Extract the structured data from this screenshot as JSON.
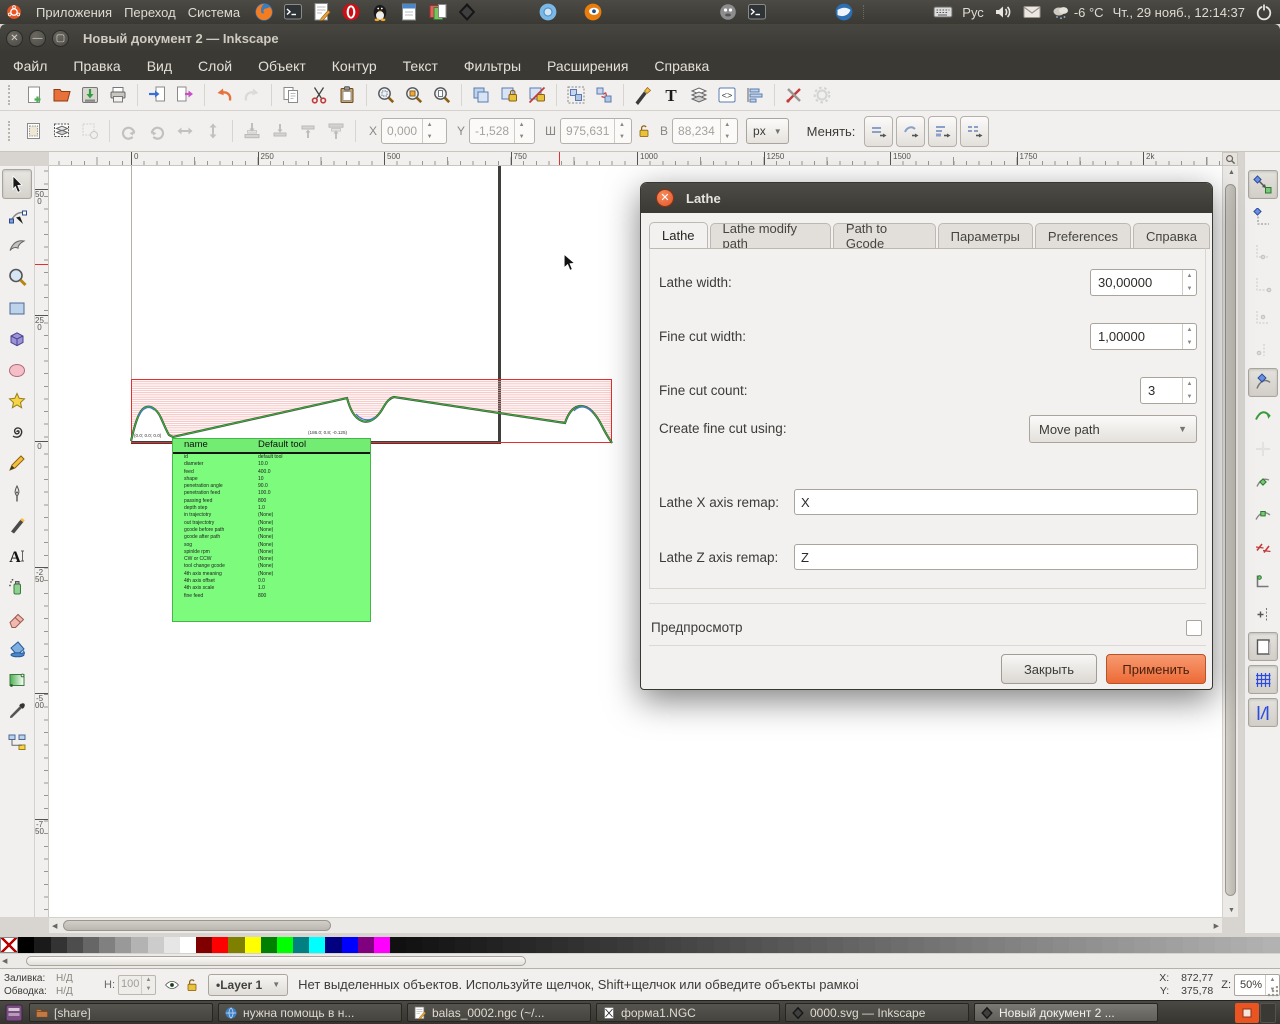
{
  "top_panel": {
    "menus": [
      "Приложения",
      "Переход",
      "Система"
    ],
    "left_icons": [
      "firefox",
      "terminal",
      "text-editor",
      "opera",
      "tux",
      "writer",
      "files",
      "inkscape",
      "chromium",
      "blender"
    ],
    "right_icons": [
      "gimp",
      "terminal",
      "thunderbird"
    ],
    "keyboard_layout": "Рус",
    "temperature": "-6 °C",
    "clock": "Чт., 29 нояб., 12:14:37"
  },
  "window": {
    "title": "Новый документ 2 — Inkscape",
    "menu_items": [
      "Файл",
      "Правка",
      "Вид",
      "Слой",
      "Объект",
      "Контур",
      "Текст",
      "Фильтры",
      "Расширения",
      "Справка"
    ]
  },
  "toolbar_commands": {
    "icons": [
      "new",
      "open",
      "save",
      "print",
      "|",
      "import",
      "export",
      "|",
      "undo",
      "redo",
      "|",
      "copy",
      "cut",
      "paste",
      "|",
      "zoom-sel",
      "zoom-draw",
      "zoom-page",
      "|",
      "duplicate",
      "clone",
      "unlink",
      "|",
      "group",
      "ungroup",
      "|",
      "fillstroke",
      "text-dialog",
      "layers",
      "xml",
      "align",
      "|",
      "toolbox-x",
      "prefs"
    ],
    "disabled": [
      "redo",
      "prefs"
    ]
  },
  "tool_controls": {
    "icons": [
      "selectall",
      "selectlayers",
      "deselect",
      "|",
      "rotccw",
      "rotcw",
      "fliph",
      "flipv",
      "|",
      "tobottom",
      "lower",
      "raise",
      "totop",
      "|"
    ],
    "disabled": [
      "deselect",
      "rotccw",
      "rotcw",
      "fliph",
      "flipv",
      "tobottom",
      "lower",
      "raise",
      "totop"
    ],
    "x_label": "X",
    "x_value": "0,000",
    "y_label": "Y",
    "y_value": "-1,528",
    "w_label": "Ш",
    "w_value": "975,631",
    "h_label": "В",
    "h_value": "88,234",
    "unit": "px",
    "affect_label": "Менять:",
    "affect_icons": [
      "affect-move",
      "affect-rotate",
      "affect-corners",
      "affect-grid"
    ]
  },
  "rulers": {
    "horizontal": [
      "0",
      "250",
      "500",
      "750",
      "1000",
      "1250",
      "1500",
      "1750",
      "2k"
    ],
    "vertical": [
      "500",
      "250",
      "0",
      "-250",
      "-500",
      "-750"
    ]
  },
  "toolbox": {
    "tools": [
      "selector",
      "node",
      "tweak",
      "zoom",
      "rect",
      "box3d",
      "ellipse",
      "star",
      "spiral",
      "pencil",
      "pen",
      "calligraphy",
      "text",
      "spray",
      "eraser",
      "bucket",
      "gradient",
      "dropper",
      "connector"
    ],
    "active": "selector"
  },
  "snap_toolbar": {
    "icons": [
      {
        "name": "snap-master",
        "pressed": true
      },
      {
        "name": "snap-bbox"
      },
      {
        "name": "snap-bbox-edge",
        "disabled": true
      },
      {
        "name": "snap-bbox-corner",
        "disabled": true
      },
      {
        "name": "snap-bbox-mid",
        "disabled": true
      },
      {
        "name": "snap-bbox-center",
        "disabled": true
      },
      {
        "name": "snap-node",
        "pressed": true
      },
      {
        "name": "snap-path"
      },
      {
        "name": "snap-intersection",
        "disabled": true
      },
      {
        "name": "snap-cusp"
      },
      {
        "name": "snap-smooth"
      },
      {
        "name": "snap-midpoint"
      },
      {
        "name": "snap-corner"
      },
      {
        "name": "snap-others"
      },
      {
        "name": "snap-page",
        "pressed": true
      },
      {
        "name": "snap-grid",
        "pressed": true
      },
      {
        "name": "snap-guide",
        "pressed": true
      }
    ]
  },
  "canvas": {
    "origin_label": "(0.0; 0.0; 0.0)",
    "mid_label": "(186.0; 0.8; -0.125)",
    "tool_table": {
      "header": [
        "name",
        "Default tool"
      ],
      "rows": [
        [
          "id",
          "default tool"
        ],
        [
          "diameter",
          "10.0"
        ],
        [
          "feed",
          "400.0"
        ],
        [
          "shape",
          "10"
        ],
        [
          "penetration angle",
          "90.0"
        ],
        [
          "penetration feed",
          "100.0"
        ],
        [
          "passing feed",
          "800"
        ],
        [
          "depth step",
          "1.0"
        ],
        [
          "in trajectotry",
          "(None)"
        ],
        [
          "out trajectotry",
          "(None)"
        ],
        [
          "gcode before path",
          "(None)"
        ],
        [
          "gcode after path",
          "(None)"
        ],
        [
          "sog",
          "(None)"
        ],
        [
          "spinlde rpm",
          "(None)"
        ],
        [
          "CW or CCW",
          "(None)"
        ],
        [
          "tool change gcode",
          "(None)"
        ],
        [
          "4th axis meaning",
          "(None)"
        ],
        [
          "4th axis offset",
          "0.0"
        ],
        [
          "4th axis scale",
          "1.0"
        ],
        [
          "fine feed",
          "800"
        ]
      ]
    }
  },
  "lathe_dialog": {
    "title": "Lathe",
    "tabs": [
      "Lathe",
      "Lathe modify path",
      "Path to Gcode",
      "Параметры",
      "Preferences",
      "Справка"
    ],
    "active_tab": "Lathe",
    "fields": {
      "lathe_width": {
        "label": "Lathe width:",
        "value": "30,00000"
      },
      "fine_cut_width": {
        "label": "Fine cut width:",
        "value": "1,00000"
      },
      "fine_cut_count": {
        "label": "Fine cut count:",
        "value": "3"
      },
      "create_fine_cut": {
        "label": "Create fine cut using:",
        "value": "Move path"
      },
      "x_remap": {
        "label": "Lathe X axis remap:",
        "value": "X"
      },
      "z_remap": {
        "label": "Lathe Z axis remap:",
        "value": "Z"
      }
    },
    "preview_label": "Предпросмотр",
    "preview_checked": false,
    "close_button": "Закрыть",
    "apply_button": "Применить",
    "accent_color": "#F07A4D"
  },
  "status_bar": {
    "fill_label": "Заливка:",
    "fill_value": "Н/Д",
    "stroke_label": "Обводка:",
    "stroke_value": "Н/Д",
    "opacity_label": "Н:",
    "opacity_value": "100",
    "layer_value": "•Layer 1",
    "message": "Нет выделенных объектов. Используйте щелчок, Shift+щелчок или обведите объекты рамкой.",
    "x_label": "X:",
    "x_value": "872,77",
    "y_label": "Y:",
    "y_value": "375,78",
    "zoom_label": "Z:",
    "zoom_value": "50%"
  },
  "taskbar": {
    "items": [
      {
        "icon": "folder",
        "label": "[share]"
      },
      {
        "icon": "globe",
        "label": "нужна помощь в н..."
      },
      {
        "icon": "text-editor",
        "label": "balas_0002.ngc (~/..."
      },
      {
        "icon": "ngc-doc",
        "label": "форма1.NGC"
      },
      {
        "icon": "inkscape",
        "label": "0000.svg — Inkscape"
      },
      {
        "icon": "inkscape",
        "label": "Новый документ 2 ...",
        "active": true
      }
    ]
  },
  "palette": {
    "swatches": [
      "none",
      "#000000",
      "#1a1a1a",
      "#333333",
      "#4d4d4d",
      "#666666",
      "#808080",
      "#999999",
      "#b3b3b3",
      "#cccccc",
      "#e6e6e6",
      "#ffffff",
      "#800000",
      "#ff0000",
      "#808000",
      "#ffff00",
      "#008000",
      "#00ff00",
      "#008080",
      "#00ffff",
      "#000080",
      "#0000ff",
      "#800080",
      "#ff00ff",
      "#101010",
      "#131313",
      "#161616",
      "#191919",
      "#1c1c1c",
      "#1f1f1f",
      "#222222",
      "#252525",
      "#282828",
      "#2b2b2b",
      "#2e2e2e",
      "#313131",
      "#343434",
      "#373737",
      "#3a3a3a",
      "#3d3d3d",
      "#404040",
      "#434343",
      "#464646",
      "#494949",
      "#4c4c4c",
      "#4f4f4f",
      "#525252",
      "#555555",
      "#585858",
      "#5b5b5b",
      "#5e5e5e",
      "#616161",
      "#646464",
      "#676767",
      "#6a6a6a",
      "#6d6d6d",
      "#707070",
      "#737373",
      "#767676",
      "#797979",
      "#7c7c7c",
      "#7f7f7f",
      "#828282",
      "#858585",
      "#888888",
      "#8b8b8b",
      "#8e8e8e",
      "#919191",
      "#949494",
      "#979797",
      "#9a9a9a",
      "#9d9d9d",
      "#a0a0a0",
      "#a3a3a3",
      "#a6a6a6",
      "#a9a9a9",
      "#acacac",
      "#afafaf",
      "#b2b2b2"
    ]
  },
  "colors": {
    "panel_bg": "#3C3B37",
    "accent_orange": "#E95420",
    "toolbar_bg": "#F1F0EE",
    "canvas_bg": "#FFFFFF",
    "hatch_red": "#F5ADAD",
    "profile_green": "#2DB82D",
    "table_green": "#7DFB7D"
  }
}
